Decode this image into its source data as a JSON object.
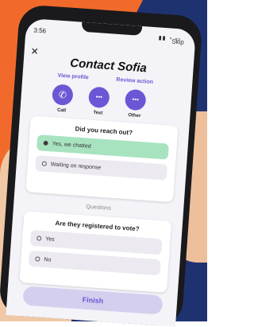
{
  "status": {
    "time": "3:56",
    "icons": "▮▮ ◔ ▭"
  },
  "header": {
    "skip": "Skip",
    "close": "✕",
    "title": "Contact Sofia"
  },
  "links": {
    "view_profile": "View profile",
    "review_action": "Review action"
  },
  "actions": [
    {
      "label": "Call",
      "glyph": "✆"
    },
    {
      "label": "Text",
      "glyph": "•••"
    },
    {
      "label": "Other",
      "glyph": "•••"
    }
  ],
  "q1": {
    "question": "Did you reach out?",
    "options": [
      "Yes, we chatted",
      "Waiting on response"
    ],
    "selected": 0
  },
  "section_label": "Questions",
  "q2": {
    "question": "Are they registered to vote?",
    "options": [
      "Yes",
      "No"
    ]
  },
  "finish": "Finish",
  "colors": {
    "accent": "#6b57d6",
    "selected": "#a8e3c0",
    "orange": "#f26a2b",
    "navy": "#1f3270"
  }
}
